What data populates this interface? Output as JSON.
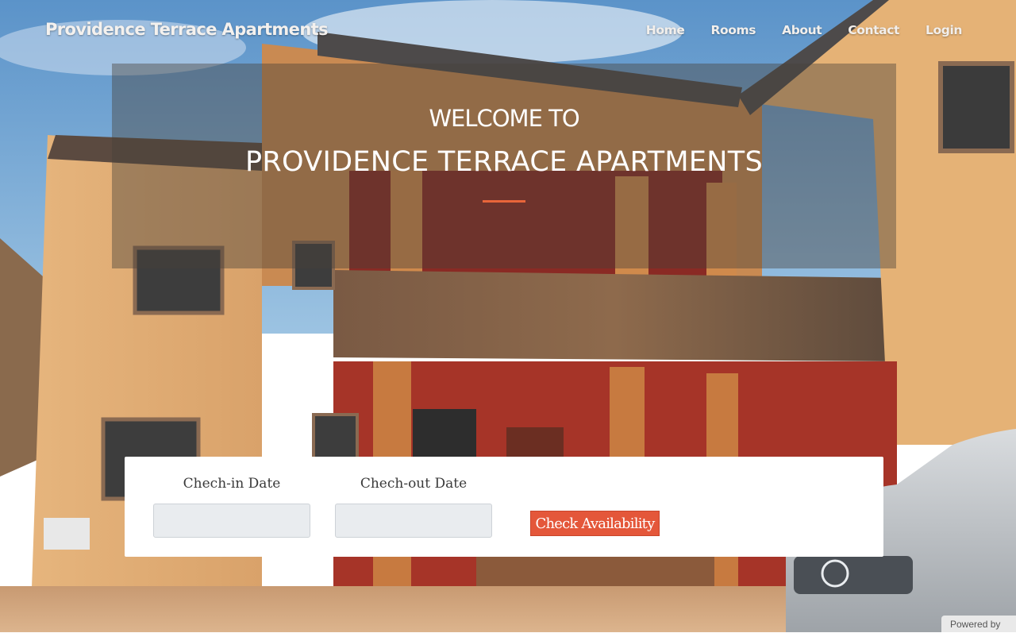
{
  "site": {
    "brand": "Providence Terrace Apartments"
  },
  "nav": {
    "items": [
      {
        "label": "Home"
      },
      {
        "label": "Rooms"
      },
      {
        "label": "About"
      },
      {
        "label": "Contact"
      },
      {
        "label": "Login"
      }
    ]
  },
  "hero": {
    "welcome_line": "WELCOME TO",
    "title": "PROVIDENCE TERRACE APARTMENTS",
    "accent_color": "#e8653a"
  },
  "booking": {
    "checkin_label": "Chech-in Date",
    "checkin_value": "",
    "checkout_label": "Chech-out Date",
    "checkout_value": "",
    "button_label": "Check Availability",
    "button_color": "#e4573a"
  },
  "footer_badge": {
    "text": "Powered by"
  }
}
